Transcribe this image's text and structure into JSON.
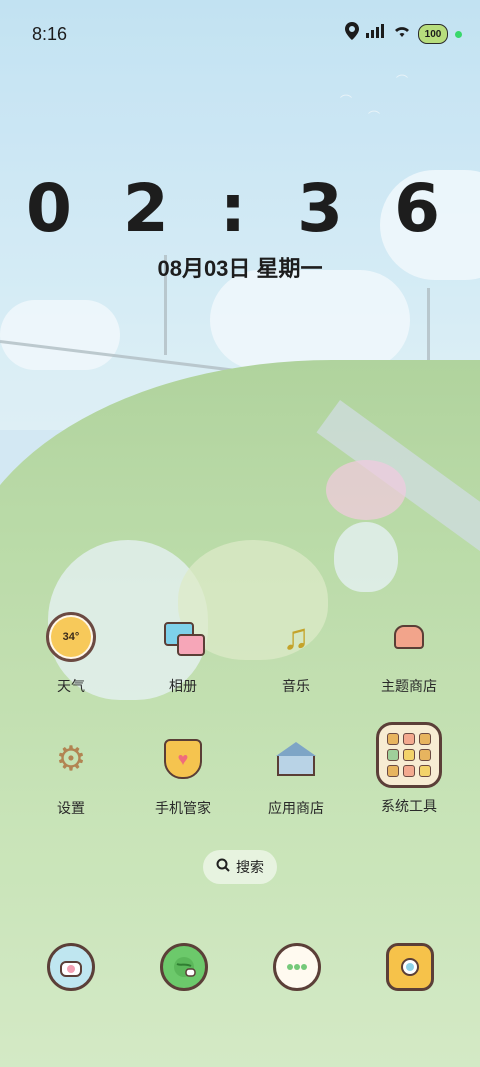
{
  "status_bar": {
    "time": "8:16",
    "battery": "100",
    "icons": [
      "location-icon",
      "signal-icon",
      "wifi-icon",
      "battery-icon",
      "indicator-dot-icon"
    ]
  },
  "clock": {
    "time": "0 2 : 3 6",
    "date": "08月03日 星期一"
  },
  "apps": [
    {
      "label": "天气",
      "icon": "weather-icon",
      "badge": "34°"
    },
    {
      "label": "相册",
      "icon": "gallery-icon"
    },
    {
      "label": "音乐",
      "icon": "music-icon"
    },
    {
      "label": "主题商店",
      "icon": "theme-store-icon"
    },
    {
      "label": "设置",
      "icon": "settings-icon"
    },
    {
      "label": "手机管家",
      "icon": "phone-manager-icon"
    },
    {
      "label": "应用商店",
      "icon": "app-store-icon"
    },
    {
      "label": "系统工具",
      "icon": "system-tools-folder-icon"
    }
  ],
  "search": {
    "label": "搜索",
    "icon": "search-icon"
  },
  "dock": [
    {
      "icon": "phone-icon"
    },
    {
      "icon": "browser-icon"
    },
    {
      "icon": "messages-icon"
    },
    {
      "icon": "camera-icon"
    }
  ],
  "colors": {
    "accent_green": "#39d86b",
    "battery_fill": "#b7dd7d",
    "icon_outline": "#5b3f38"
  }
}
